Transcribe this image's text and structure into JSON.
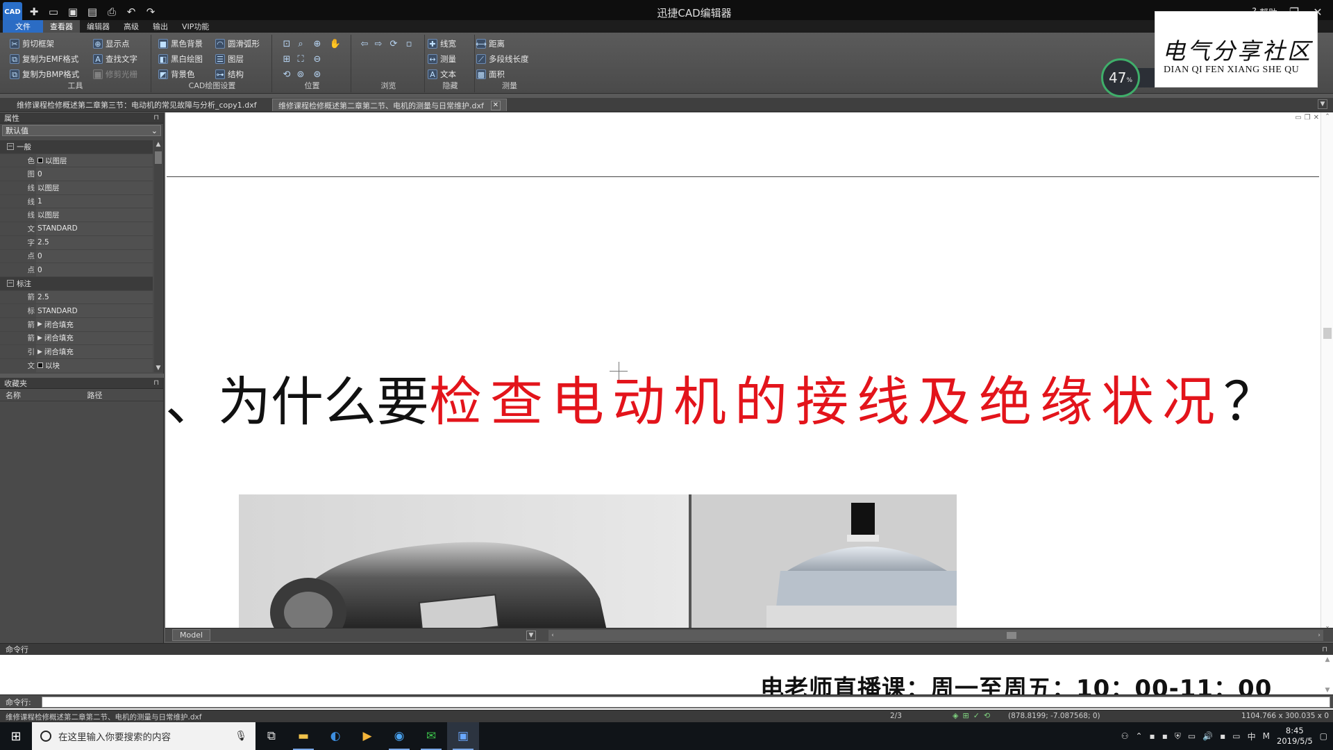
{
  "app": {
    "title": "迅捷CAD编辑器",
    "logo": "CAD",
    "help_label": "帮助"
  },
  "menu": [
    "文件",
    "查看器",
    "编辑器",
    "高级",
    "输出",
    "VIP功能"
  ],
  "ribbon": {
    "tools": {
      "label": "工具",
      "items": [
        "剪切框架",
        "复制为EMF格式",
        "复制为BMP格式",
        "显示点",
        "查找文字",
        "修剪光栅"
      ]
    },
    "cad_settings": {
      "label": "CAD绘图设置",
      "items": [
        "黑色背景",
        "黑白绘图",
        "背景色",
        "圆滑弧形",
        "图层",
        "结构"
      ]
    },
    "position": {
      "label": "位置"
    },
    "browse": {
      "label": "浏览"
    },
    "hide": {
      "label": "隐藏",
      "items": [
        "线宽",
        "测量",
        "文本"
      ]
    },
    "measure": {
      "label": "测量",
      "items": [
        "距离",
        "多段线长度",
        "面积"
      ]
    }
  },
  "doc_tabs": [
    {
      "label": "维修课程检修概述第二章第三节：电动机的常见故障与分析_copy1.dxf",
      "active": false
    },
    {
      "label": "维修课程检修概述第二章第二节、电机的测量与日常维护.dxf",
      "active": true
    }
  ],
  "properties": {
    "title": "属性",
    "selector": "默认值",
    "rows": [
      {
        "type": "cat",
        "name": "一般",
        "toggle": "−"
      },
      {
        "name": "色",
        "value": "以图层",
        "swatch": true
      },
      {
        "name": "图",
        "value": "0"
      },
      {
        "name": "线",
        "value": "以图层"
      },
      {
        "name": "线",
        "value": "1"
      },
      {
        "name": "线",
        "value": "以图层"
      },
      {
        "name": "文",
        "value": "STANDARD"
      },
      {
        "name": "字",
        "value": "2.5"
      },
      {
        "name": "点",
        "value": "0"
      },
      {
        "name": "点",
        "value": "0"
      },
      {
        "type": "cat",
        "name": "标注",
        "toggle": "−"
      },
      {
        "name": "箭",
        "value": "2.5"
      },
      {
        "name": "标",
        "value": "STANDARD"
      },
      {
        "name": "箭",
        "value": "闭合填充",
        "arrow": true
      },
      {
        "name": "箭",
        "value": "闭合填充",
        "arrow": true
      },
      {
        "name": "引",
        "value": "闭合填充",
        "arrow": true
      },
      {
        "name": "文",
        "value": "以块",
        "swatch": true
      }
    ]
  },
  "favorites": {
    "title": "收藏夹",
    "col_name": "名称",
    "col_path": "路径"
  },
  "canvas": {
    "heading_black_prefix": "、为什么要",
    "heading_red": "检查电动机的接线及绝缘状况",
    "heading_black_suffix": "？"
  },
  "model_tab": "Model",
  "command": {
    "title": "命令行",
    "label": "命令行:"
  },
  "banner": "电老师直播课：周一至周五：10：00-11：00",
  "status": {
    "file": "维修课程检修概述第二章第二节、电机的测量与日常维护.dxf",
    "page": "2/3",
    "coords": "(878.8199; -7.087568; 0)",
    "size": "1104.766 x 300.035 x 0"
  },
  "taskbar": {
    "search_placeholder": "在这里输入你要搜索的内容",
    "time": "8:45",
    "date": "2019/5/5",
    "ime": "中"
  },
  "watermark": {
    "cn": "电气分享社区",
    "en": "DIAN QI FEN XIANG SHE QU"
  },
  "speed_widget": {
    "value": "47",
    "unit": "%"
  },
  "colors": {
    "accent": "#2b6cc4",
    "heading_red": "#e3141b"
  }
}
